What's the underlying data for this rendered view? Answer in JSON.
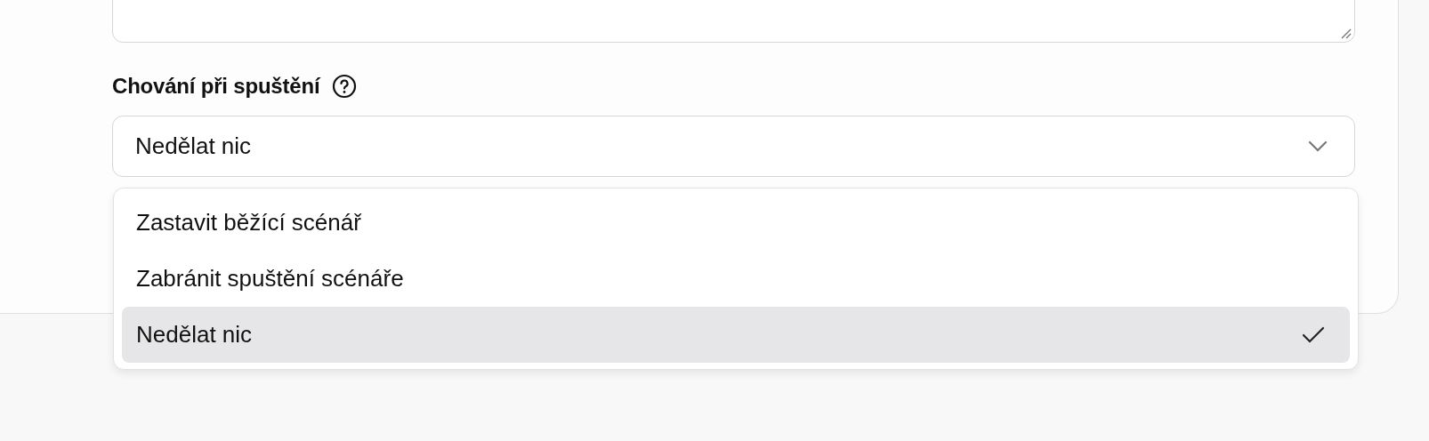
{
  "launch_behavior": {
    "label": "Chování při spuštění",
    "value": "Nedělat nic",
    "expanded": true,
    "options": [
      {
        "label": "Zastavit běžící scénář",
        "selected": false
      },
      {
        "label": "Zabránit spuštění scénáře",
        "selected": false
      },
      {
        "label": "Nedělat nic",
        "selected": true
      }
    ]
  }
}
